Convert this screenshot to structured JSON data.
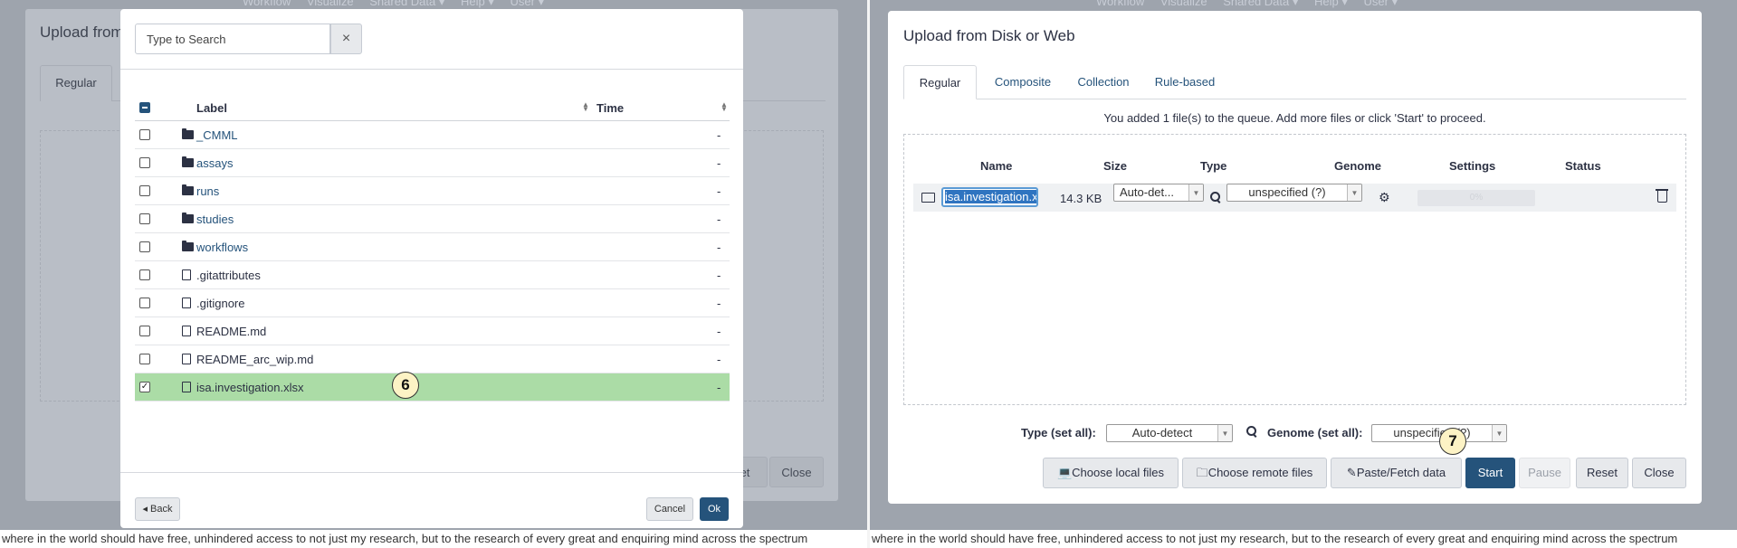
{
  "nav": {
    "items": [
      "Workflow",
      "Visualize",
      "Shared Data ▾",
      "Help ▾",
      "User ▾"
    ]
  },
  "footer_text": "where in the world should have free, unhindered access to not just my research, but to the research of every great and enquiring mind across the spectrum",
  "left": {
    "bg_dialog": {
      "title": "Upload from",
      "tab": "Regular",
      "btn_partial": "et",
      "close": "Close"
    },
    "picker": {
      "search_placeholder": "Type to Search",
      "clear_icon": "×",
      "columns": {
        "label": "Label",
        "time": "Time"
      },
      "rows": [
        {
          "name": "_CMML",
          "kind": "folder",
          "time": "-",
          "checked": false
        },
        {
          "name": "assays",
          "kind": "folder",
          "time": "-",
          "checked": false
        },
        {
          "name": "runs",
          "kind": "folder",
          "time": "-",
          "checked": false
        },
        {
          "name": "studies",
          "kind": "folder",
          "time": "-",
          "checked": false
        },
        {
          "name": "workflows",
          "kind": "folder",
          "time": "-",
          "checked": false
        },
        {
          "name": ".gitattributes",
          "kind": "file",
          "time": "-",
          "checked": false
        },
        {
          "name": ".gitignore",
          "kind": "file",
          "time": "-",
          "checked": false
        },
        {
          "name": "README.md",
          "kind": "file",
          "time": "-",
          "checked": false
        },
        {
          "name": "README_arc_wip.md",
          "kind": "file",
          "time": "-",
          "checked": false
        },
        {
          "name": "isa.investigation.xlsx",
          "kind": "file",
          "time": "-",
          "checked": true
        }
      ],
      "step_marker": "6",
      "back": "Back",
      "cancel": "Cancel",
      "ok": "Ok"
    }
  },
  "right": {
    "title": "Upload from Disk or Web",
    "tabs": [
      "Regular",
      "Composite",
      "Collection",
      "Rule-based"
    ],
    "queue_message": "You added 1 file(s) to the queue. Add more files or click 'Start' to proceed.",
    "columns": [
      "Name",
      "Size",
      "Type",
      "Genome",
      "Settings",
      "Status"
    ],
    "queue_item": {
      "name": "isa.investigation.xlsx",
      "size": "14.3 KB",
      "type": "Auto-det...",
      "genome": "unspecified (?)",
      "progress": "0%"
    },
    "set_all": {
      "type_label": "Type (set all):",
      "type_value": "Auto-detect",
      "genome_label": "Genome (set all):",
      "genome_value": "unspecified (?)"
    },
    "step_marker": "7",
    "buttons": {
      "choose_local": "Choose local files",
      "choose_remote": "Choose remote files",
      "paste_fetch": "Paste/Fetch data",
      "start": "Start",
      "pause": "Pause",
      "reset": "Reset",
      "close": "Close"
    }
  }
}
